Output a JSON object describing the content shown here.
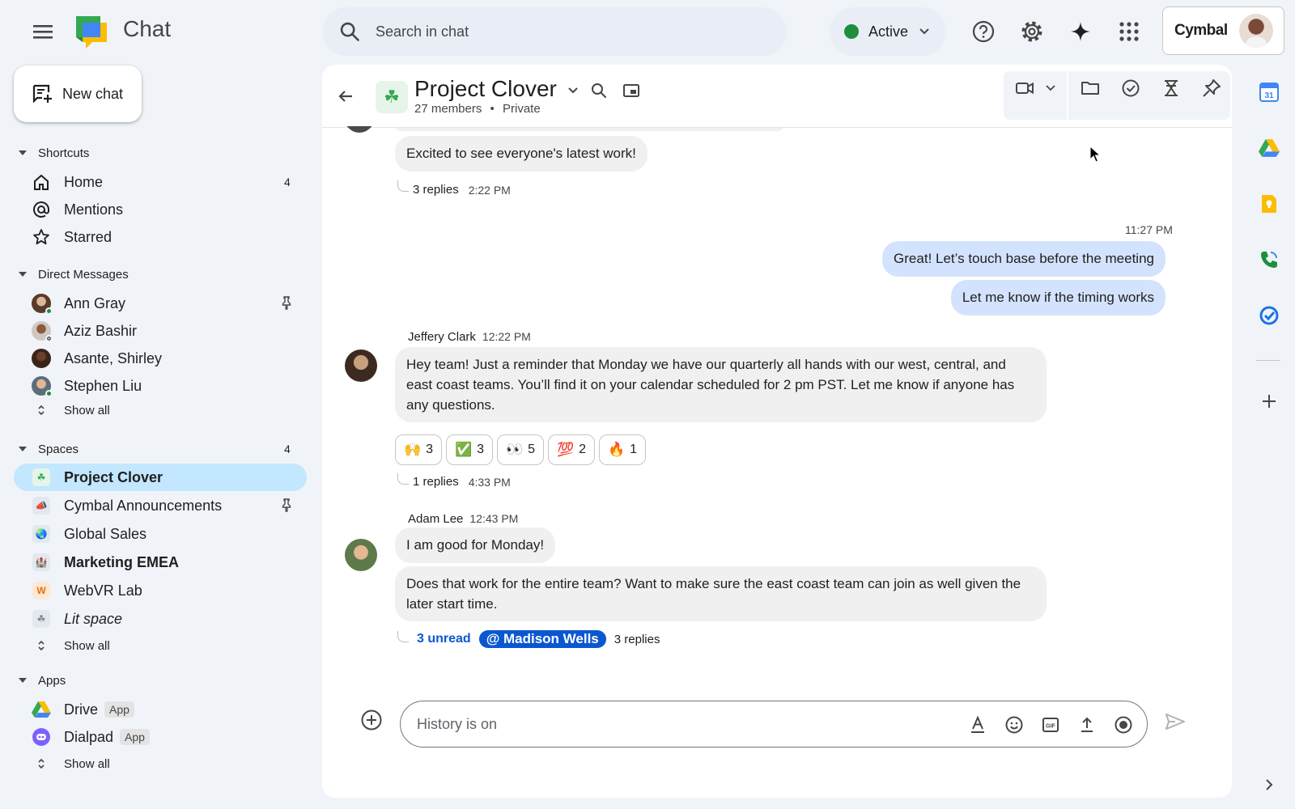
{
  "app": {
    "title": "Chat"
  },
  "search": {
    "placeholder": "Search in chat"
  },
  "status": {
    "label": "Active",
    "color": "#1e8e3e"
  },
  "account": {
    "brand": "Cymbal"
  },
  "top_icons": [
    "help-icon",
    "settings-gear-icon",
    "gemini-sparkle-icon",
    "apps-grid-icon"
  ],
  "sidebar": {
    "new_chat_label": "New chat",
    "shortcuts": {
      "heading": "Shortcuts",
      "items": [
        {
          "label": "Home",
          "icon": "home-icon",
          "count": "4"
        },
        {
          "label": "Mentions",
          "icon": "at-icon"
        },
        {
          "label": "Starred",
          "icon": "star-icon"
        }
      ]
    },
    "direct_messages": {
      "heading": "Direct Messages",
      "items": [
        {
          "label": "Ann Gray",
          "pinned": true,
          "presence": "active"
        },
        {
          "label": "Aziz Bashir",
          "presence": "away"
        },
        {
          "label": "Asante, Shirley"
        },
        {
          "label": "Stephen Liu",
          "presence": "active"
        }
      ],
      "show_all": "Show all"
    },
    "spaces": {
      "heading": "Spaces",
      "count": "4",
      "items": [
        {
          "label": "Project Clover",
          "selected": true,
          "emoji": "☘"
        },
        {
          "label": "Cymbal Announcements",
          "pinned": true,
          "emoji": "📣"
        },
        {
          "label": "Global Sales",
          "emoji": "🌏"
        },
        {
          "label": "Marketing EMEA",
          "bold": true,
          "emoji": "🏰"
        },
        {
          "label": "WebVR Lab",
          "emoji": "W"
        },
        {
          "label": "Lit space",
          "italic": true,
          "emoji": "☘"
        }
      ],
      "show_all": "Show all"
    },
    "apps": {
      "heading": "Apps",
      "items": [
        {
          "label": "Drive",
          "badge": "App",
          "icon": "drive-icon"
        },
        {
          "label": "Dialpad",
          "badge": "App",
          "icon": "dialpad-icon"
        }
      ],
      "show_all": "Show all"
    }
  },
  "space": {
    "title": "Project Clover",
    "members": "27 members",
    "privacy": "Private",
    "separator": "•"
  },
  "header_tools": [
    "video-call-icon",
    "files-folder-icon",
    "tasks-check-icon",
    "hourglass-icon",
    "pin-icon"
  ],
  "messages": {
    "m1": {
      "text": "Excited to see everyone's latest work!",
      "replies": "3 replies",
      "time": "2:22 PM"
    },
    "me": {
      "time": "11:27 PM",
      "lines": [
        "Great! Let’s touch base before the meeting",
        "Let me know if the timing works"
      ]
    },
    "jeffery": {
      "sender": "Jeffery Clark",
      "time": "12:22 PM",
      "text": "Hey team! Just a reminder that Monday we have our quarterly all hands with our west, central, and east coast teams. You’ll find it on your calendar scheduled for 2 pm PST. Let me know if anyone has any questions.",
      "reactions": [
        {
          "emoji": "🙌",
          "count": "3"
        },
        {
          "emoji": "✅",
          "count": "3"
        },
        {
          "emoji": "👀",
          "count": "5"
        },
        {
          "emoji": "💯",
          "count": "2"
        },
        {
          "emoji": "🔥",
          "count": "1"
        }
      ],
      "replies": "1 replies",
      "reply_time": "4:33 PM"
    },
    "adam": {
      "sender": "Adam Lee",
      "time": "12:43 PM",
      "text1": "I am good for Monday!",
      "text2": "Does that work for the entire team? Want to make sure the east coast team can join as well given the later start time.",
      "unread": "3 unread",
      "mention": "@ Madison Wells",
      "replies": "3 replies"
    }
  },
  "compose": {
    "placeholder": "History is on"
  },
  "compose_tools": [
    "text-format-icon",
    "emoji-icon",
    "gif-icon",
    "upload-icon",
    "record-icon"
  ],
  "right_rail": [
    "calendar-icon",
    "drive-icon",
    "keep-icon",
    "dialpad-icon",
    "tasks-icon",
    "add-icon"
  ]
}
